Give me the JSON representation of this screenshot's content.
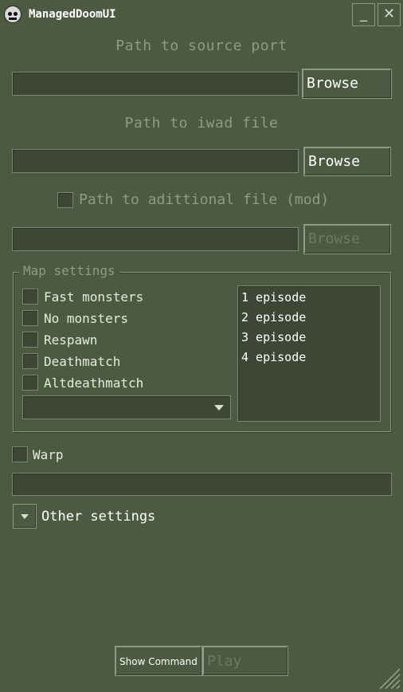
{
  "window": {
    "title": "ManagedDoomUI",
    "minimize_glyph": "_",
    "close_glyph": "✕"
  },
  "source_port": {
    "label": "Path to source port",
    "value": "",
    "browse_label": "Browse"
  },
  "iwad": {
    "label": "Path to iwad file",
    "value": "",
    "browse_label": "Browse"
  },
  "mod": {
    "checkbox_label": "Path to adittional file (mod)",
    "checked": false,
    "value": "",
    "browse_label": "Browse",
    "enabled": false
  },
  "map_settings": {
    "title": "Map settings",
    "options": [
      {
        "label": "Fast monsters",
        "checked": false
      },
      {
        "label": "No monsters",
        "checked": false
      },
      {
        "label": "Respawn",
        "checked": false
      },
      {
        "label": "Deathmatch",
        "checked": false
      },
      {
        "label": "Altdeathmatch",
        "checked": false
      }
    ],
    "skill_selected": "",
    "episodes": [
      "1 episode",
      "2 episode",
      "3 episode",
      "4 episode"
    ]
  },
  "warp": {
    "label": "Warp",
    "checked": false,
    "value": ""
  },
  "other_settings": {
    "label": "Other settings",
    "expanded": false
  },
  "footer": {
    "show_command_label": "Show Command",
    "play_label": "Play",
    "play_enabled": false
  },
  "colors": {
    "background": "#4b5a41",
    "field": "#3e4735",
    "border_light": "#8f9c84",
    "dim_text": "#8f9b86"
  },
  "icons": {
    "app": "doom-face-icon",
    "dropdown": "chevron-down-icon",
    "resize": "resize-grip-icon"
  }
}
